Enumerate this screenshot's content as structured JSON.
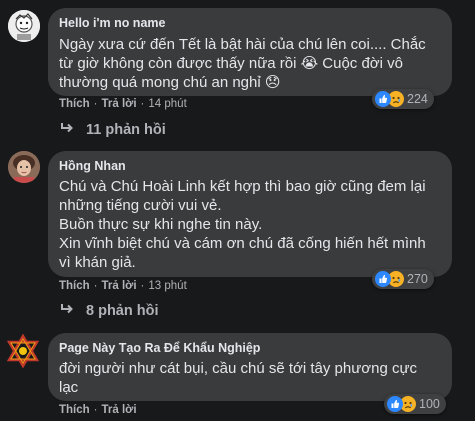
{
  "comments": [
    {
      "author": "Hello i'm no name",
      "lines": [
        "Ngày xưa cứ đến Tết là bật hài của chú lên coi.... Chắc",
        "từ giờ không còn được thấy nữa rồi 😭 Cuộc đời vô",
        "thường quá mong chú an nghỉ 😞"
      ],
      "like_label": "Thích",
      "reply_label": "Trả lời",
      "time": "14 phút",
      "reaction_count": "224",
      "reaction_icons": [
        "like-icon",
        "sad-icon"
      ],
      "replies_label": "11 phản hồi"
    },
    {
      "author": "Hồng Nhan",
      "lines": [
        "Chú và Chú Hoài Linh kết hợp thì bao giờ cũng đem lại",
        "những tiếng cười vui vẻ.",
        "Buồn thực sự khi nghe tin này.",
        "Xin vĩnh biệt chú và cám ơn chú đã cống hiến hết mình",
        "vì khán giả."
      ],
      "like_label": "Thích",
      "reply_label": "Trả lời",
      "time": "13 phút",
      "reaction_count": "270",
      "reaction_icons": [
        "like-icon",
        "sad-icon"
      ],
      "replies_label": "8 phản hồi"
    },
    {
      "author": "Page Này Tạo Ra Để Khẩu Nghiệp",
      "lines": [
        "đời người như cát bụi, cầu chú sẽ tới tây phương cực",
        "lạc"
      ],
      "like_label": "Thích",
      "reply_label": "Trả lời",
      "time": "",
      "reaction_count": "100",
      "reaction_icons": [
        "like-icon",
        "sad-icon"
      ]
    }
  ],
  "colors": {
    "background": "#18191a",
    "bubble": "#3a3b3c",
    "text": "#e4e6eb",
    "secondary": "#b0b3b8",
    "like": "#2d88ff",
    "sad": "#f7b125"
  }
}
